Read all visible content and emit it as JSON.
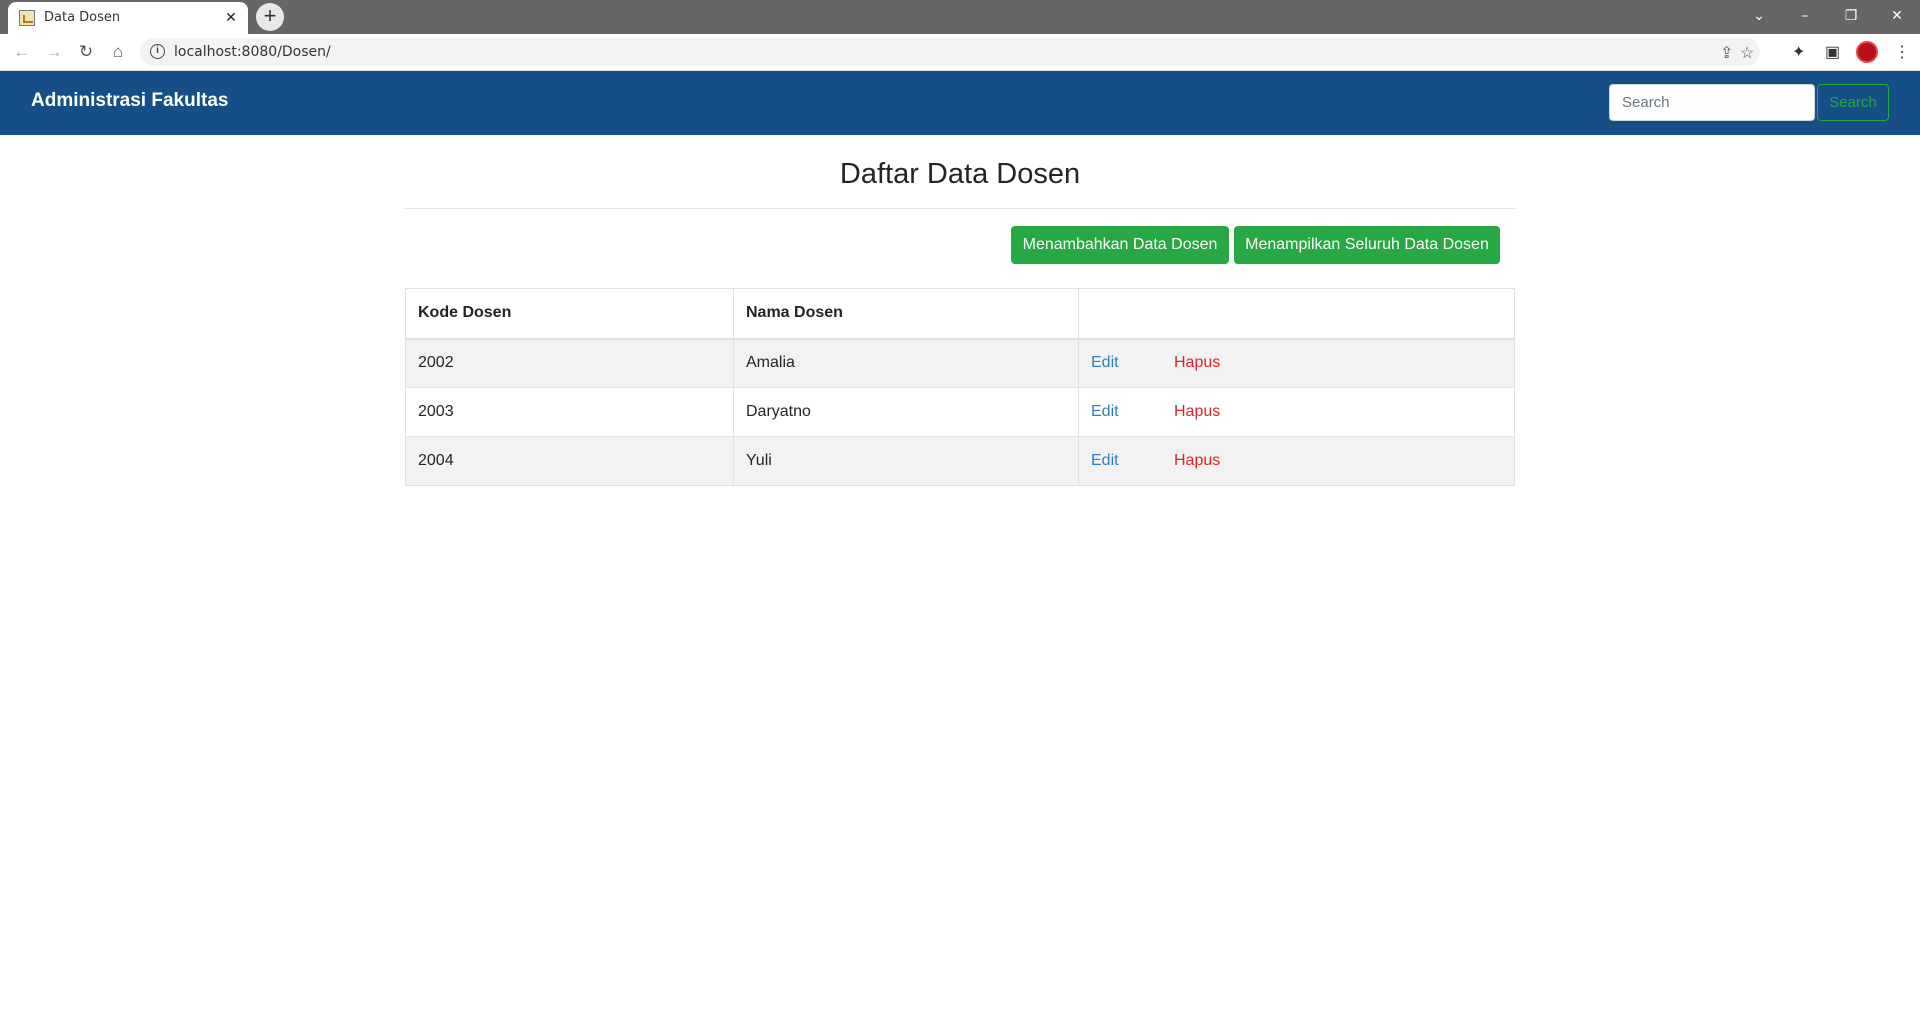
{
  "browser": {
    "tab_title": "Data Dosen",
    "tab_close": "✕",
    "new_tab": "+",
    "url": "localhost:8080/Dosen/",
    "window_controls": {
      "dropdown": "⌄",
      "minimize": "–",
      "restore": "❐",
      "close": "✕"
    }
  },
  "navbar": {
    "brand": "Administrasi Fakultas",
    "search_placeholder": "Search",
    "search_button": "Search",
    "bg_color": "#154f86"
  },
  "page": {
    "title": "Daftar Data Dosen",
    "add_button": "Menambahkan Data Dosen",
    "show_all_button": "Menampilkan Seluruh Data Dosen"
  },
  "table": {
    "headers": [
      "Kode Dosen",
      "Nama Dosen",
      ""
    ],
    "rows": [
      {
        "kode": "2002",
        "nama": "Amalia",
        "edit": "Edit",
        "hapus": "Hapus"
      },
      {
        "kode": "2003",
        "nama": "Daryatno",
        "edit": "Edit",
        "hapus": "Hapus"
      },
      {
        "kode": "2004",
        "nama": "Yuli",
        "edit": "Edit",
        "hapus": "Hapus"
      }
    ]
  },
  "colors": {
    "accent_green": "#28a745",
    "edit_link": "#2f7ec1",
    "delete_link": "#d9262b"
  }
}
